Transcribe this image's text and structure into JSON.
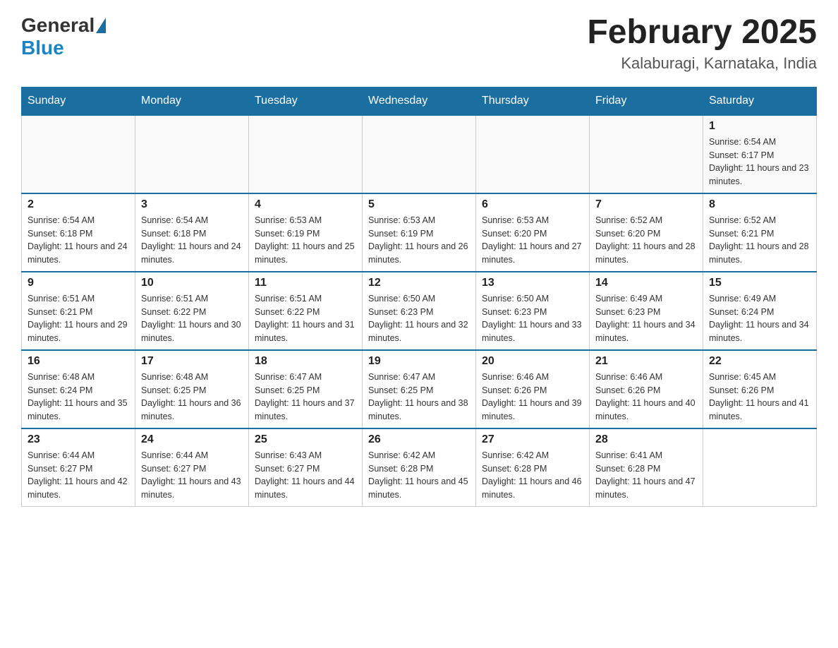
{
  "header": {
    "logo_general": "General",
    "logo_blue": "Blue",
    "month_title": "February 2025",
    "location": "Kalaburagi, Karnataka, India"
  },
  "weekdays": [
    "Sunday",
    "Monday",
    "Tuesday",
    "Wednesday",
    "Thursday",
    "Friday",
    "Saturday"
  ],
  "weeks": [
    [
      {
        "day": "",
        "info": ""
      },
      {
        "day": "",
        "info": ""
      },
      {
        "day": "",
        "info": ""
      },
      {
        "day": "",
        "info": ""
      },
      {
        "day": "",
        "info": ""
      },
      {
        "day": "",
        "info": ""
      },
      {
        "day": "1",
        "info": "Sunrise: 6:54 AM\nSunset: 6:17 PM\nDaylight: 11 hours and 23 minutes."
      }
    ],
    [
      {
        "day": "2",
        "info": "Sunrise: 6:54 AM\nSunset: 6:18 PM\nDaylight: 11 hours and 24 minutes."
      },
      {
        "day": "3",
        "info": "Sunrise: 6:54 AM\nSunset: 6:18 PM\nDaylight: 11 hours and 24 minutes."
      },
      {
        "day": "4",
        "info": "Sunrise: 6:53 AM\nSunset: 6:19 PM\nDaylight: 11 hours and 25 minutes."
      },
      {
        "day": "5",
        "info": "Sunrise: 6:53 AM\nSunset: 6:19 PM\nDaylight: 11 hours and 26 minutes."
      },
      {
        "day": "6",
        "info": "Sunrise: 6:53 AM\nSunset: 6:20 PM\nDaylight: 11 hours and 27 minutes."
      },
      {
        "day": "7",
        "info": "Sunrise: 6:52 AM\nSunset: 6:20 PM\nDaylight: 11 hours and 28 minutes."
      },
      {
        "day": "8",
        "info": "Sunrise: 6:52 AM\nSunset: 6:21 PM\nDaylight: 11 hours and 28 minutes."
      }
    ],
    [
      {
        "day": "9",
        "info": "Sunrise: 6:51 AM\nSunset: 6:21 PM\nDaylight: 11 hours and 29 minutes."
      },
      {
        "day": "10",
        "info": "Sunrise: 6:51 AM\nSunset: 6:22 PM\nDaylight: 11 hours and 30 minutes."
      },
      {
        "day": "11",
        "info": "Sunrise: 6:51 AM\nSunset: 6:22 PM\nDaylight: 11 hours and 31 minutes."
      },
      {
        "day": "12",
        "info": "Sunrise: 6:50 AM\nSunset: 6:23 PM\nDaylight: 11 hours and 32 minutes."
      },
      {
        "day": "13",
        "info": "Sunrise: 6:50 AM\nSunset: 6:23 PM\nDaylight: 11 hours and 33 minutes."
      },
      {
        "day": "14",
        "info": "Sunrise: 6:49 AM\nSunset: 6:23 PM\nDaylight: 11 hours and 34 minutes."
      },
      {
        "day": "15",
        "info": "Sunrise: 6:49 AM\nSunset: 6:24 PM\nDaylight: 11 hours and 34 minutes."
      }
    ],
    [
      {
        "day": "16",
        "info": "Sunrise: 6:48 AM\nSunset: 6:24 PM\nDaylight: 11 hours and 35 minutes."
      },
      {
        "day": "17",
        "info": "Sunrise: 6:48 AM\nSunset: 6:25 PM\nDaylight: 11 hours and 36 minutes."
      },
      {
        "day": "18",
        "info": "Sunrise: 6:47 AM\nSunset: 6:25 PM\nDaylight: 11 hours and 37 minutes."
      },
      {
        "day": "19",
        "info": "Sunrise: 6:47 AM\nSunset: 6:25 PM\nDaylight: 11 hours and 38 minutes."
      },
      {
        "day": "20",
        "info": "Sunrise: 6:46 AM\nSunset: 6:26 PM\nDaylight: 11 hours and 39 minutes."
      },
      {
        "day": "21",
        "info": "Sunrise: 6:46 AM\nSunset: 6:26 PM\nDaylight: 11 hours and 40 minutes."
      },
      {
        "day": "22",
        "info": "Sunrise: 6:45 AM\nSunset: 6:26 PM\nDaylight: 11 hours and 41 minutes."
      }
    ],
    [
      {
        "day": "23",
        "info": "Sunrise: 6:44 AM\nSunset: 6:27 PM\nDaylight: 11 hours and 42 minutes."
      },
      {
        "day": "24",
        "info": "Sunrise: 6:44 AM\nSunset: 6:27 PM\nDaylight: 11 hours and 43 minutes."
      },
      {
        "day": "25",
        "info": "Sunrise: 6:43 AM\nSunset: 6:27 PM\nDaylight: 11 hours and 44 minutes."
      },
      {
        "day": "26",
        "info": "Sunrise: 6:42 AM\nSunset: 6:28 PM\nDaylight: 11 hours and 45 minutes."
      },
      {
        "day": "27",
        "info": "Sunrise: 6:42 AM\nSunset: 6:28 PM\nDaylight: 11 hours and 46 minutes."
      },
      {
        "day": "28",
        "info": "Sunrise: 6:41 AM\nSunset: 6:28 PM\nDaylight: 11 hours and 47 minutes."
      },
      {
        "day": "",
        "info": ""
      }
    ]
  ]
}
